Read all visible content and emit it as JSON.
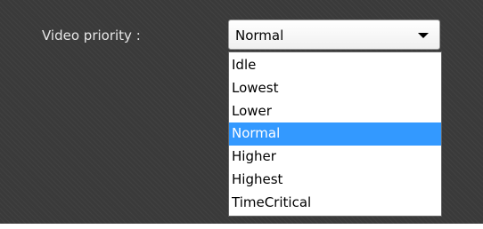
{
  "setting": {
    "label": "Video priority :"
  },
  "combobox": {
    "value": "Normal",
    "arrow_icon": "chevron-down-icon"
  },
  "dropdown": {
    "options": [
      "Idle",
      "Lowest",
      "Lower",
      "Normal",
      "Higher",
      "Highest",
      "TimeCritical"
    ],
    "selected_option": "Normal",
    "highlight_color": "#3399ff"
  }
}
